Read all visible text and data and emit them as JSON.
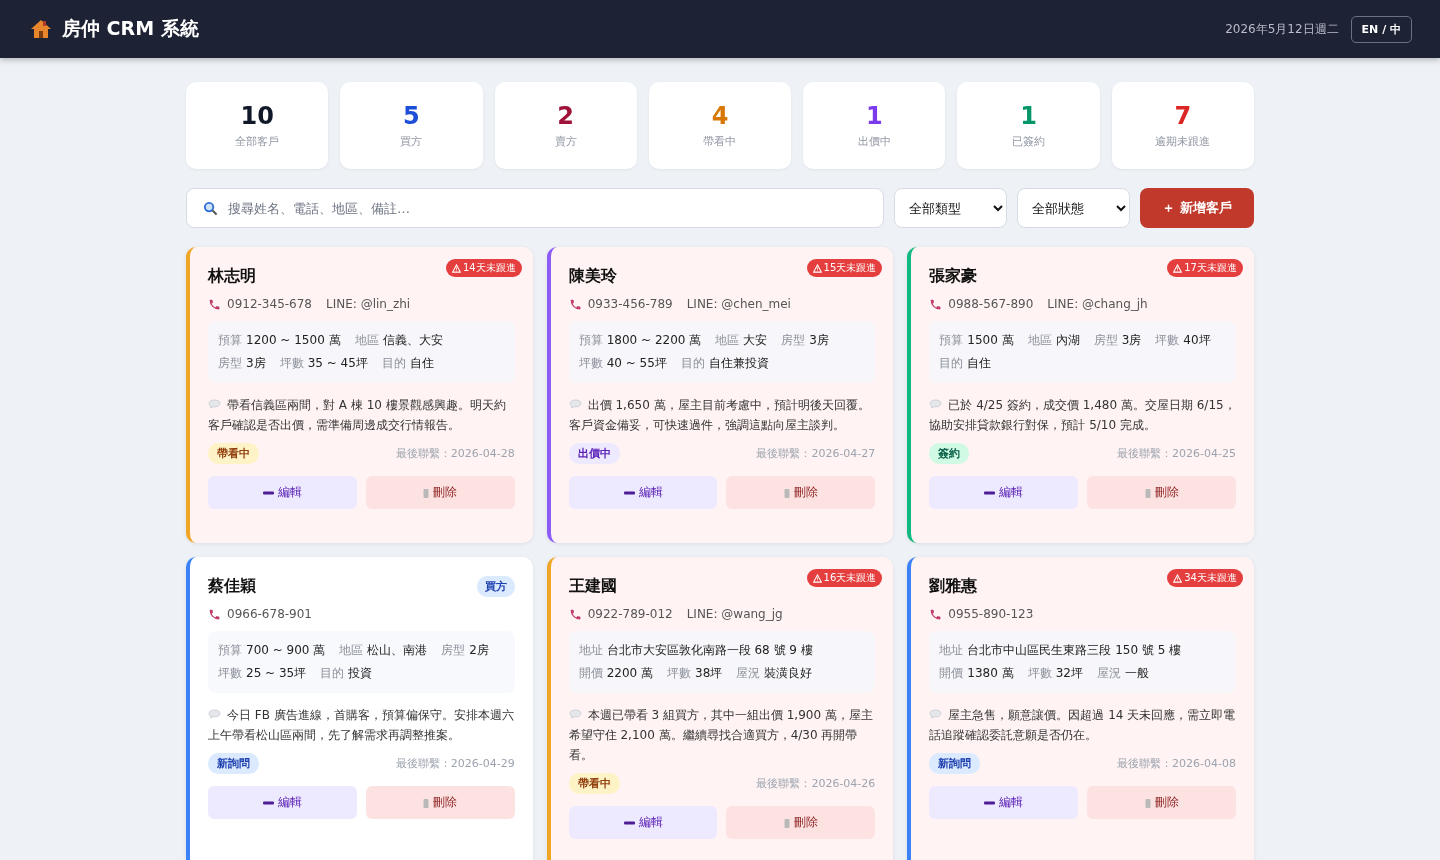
{
  "header": {
    "title": "房仲 CRM 系統",
    "date": "2026年5月12日週二",
    "language_button": "EN / 中"
  },
  "stats": [
    {
      "value": "10",
      "label": "全部客戶",
      "color": "#111827"
    },
    {
      "value": "5",
      "label": "買方",
      "color": "#1d4ed8"
    },
    {
      "value": "2",
      "label": "賣方",
      "color": "#9f1239"
    },
    {
      "value": "4",
      "label": "帶看中",
      "color": "#d97706"
    },
    {
      "value": "1",
      "label": "出價中",
      "color": "#7c3aed"
    },
    {
      "value": "1",
      "label": "已簽約",
      "color": "#059669"
    },
    {
      "value": "7",
      "label": "逾期未跟進",
      "color": "#dc2626"
    }
  ],
  "toolbar": {
    "search": {
      "placeholder": "搜尋姓名、電話、地區、備註…"
    },
    "type_filter": "全部類型",
    "status_filter": "全部狀態",
    "add_button": "＋ 新增客戶"
  },
  "clients": [
    {
      "name": "林志明",
      "overdue": "14天未跟進",
      "phone": "0912-345-678",
      "line": "LINE: @lin_zhi",
      "details": [
        {
          "label": "預算",
          "value": "1200 ~ 1500 萬"
        },
        {
          "label": "地區",
          "value": "信義、大安"
        },
        {
          "label": "房型",
          "value": "3房"
        },
        {
          "label": "坪數",
          "value": "35 ~ 45坪"
        },
        {
          "label": "目的",
          "value": "自住"
        }
      ],
      "note": "帶看信義區兩間，對 A 棟 10 樓景觀感興趣。明天約客戶確認是否出價，需準備周邊成交行情報告。",
      "status": {
        "kind": "viewing",
        "label": "帶看中"
      },
      "last_contact": "最後聯繫：2026-04-28",
      "edit": "編輯",
      "delete": "刪除"
    },
    {
      "name": "陳美玲",
      "overdue": "15天未跟進",
      "phone": "0933-456-789",
      "line": "LINE: @chen_mei",
      "details": [
        {
          "label": "預算",
          "value": "1800 ~ 2200 萬"
        },
        {
          "label": "地區",
          "value": "大安"
        },
        {
          "label": "房型",
          "value": "3房"
        },
        {
          "label": "坪數",
          "value": "40 ~ 55坪"
        },
        {
          "label": "目的",
          "value": "自住兼投資"
        }
      ],
      "note": "出價 1,650 萬，屋主目前考慮中，預計明後天回覆。客戶資金備妥，可快速過件，強調這點向屋主談判。",
      "status": {
        "kind": "offer",
        "label": "出價中"
      },
      "last_contact": "最後聯繫：2026-04-27",
      "edit": "編輯",
      "delete": "刪除"
    },
    {
      "name": "張家豪",
      "overdue": "17天未跟進",
      "phone": "0988-567-890",
      "line": "LINE: @chang_jh",
      "details": [
        {
          "label": "預算",
          "value": "1500 萬"
        },
        {
          "label": "地區",
          "value": "內湖"
        },
        {
          "label": "房型",
          "value": "3房"
        },
        {
          "label": "坪數",
          "value": "40坪"
        },
        {
          "label": "目的",
          "value": "自住"
        }
      ],
      "note": "已於 4/25 簽約，成交價 1,480 萬。交屋日期 6/15，協助安排貸款銀行對保，預計 5/10 完成。",
      "status": {
        "kind": "signed",
        "label": "簽約"
      },
      "last_contact": "最後聯繫：2026-04-25",
      "edit": "編輯",
      "delete": "刪除"
    },
    {
      "name": "蔡佳穎",
      "type": "買方",
      "phone": "0966-678-901",
      "details": [
        {
          "label": "預算",
          "value": "700 ~ 900 萬"
        },
        {
          "label": "地區",
          "value": "松山、南港"
        },
        {
          "label": "房型",
          "value": "2房"
        },
        {
          "label": "坪數",
          "value": "25 ~ 35坪"
        },
        {
          "label": "目的",
          "value": "投資"
        }
      ],
      "note": "今日 FB 廣告進線，首購客，預算偏保守。安排本週六上午帶看松山區兩間，先了解需求再調整推案。",
      "status": {
        "kind": "new",
        "label": "新詢問"
      },
      "last_contact": "最後聯繫：2026-04-29",
      "edit": "編輯",
      "delete": "刪除"
    },
    {
      "name": "王建國",
      "overdue": "16天未跟進",
      "phone": "0922-789-012",
      "line": "LINE: @wang_jg",
      "details": [
        {
          "label": "地址",
          "value": "台北市大安區敦化南路一段 68 號 9 樓"
        },
        {
          "label": "開價",
          "value": "2200 萬"
        },
        {
          "label": "坪數",
          "value": "38坪"
        },
        {
          "label": "屋況",
          "value": "裝潢良好"
        }
      ],
      "note": "本週已帶看 3 組買方，其中一組出價 1,900 萬，屋主希望守住 2,100 萬。繼續尋找合適買方，4/30 再開帶看。",
      "status": {
        "kind": "viewing",
        "label": "帶看中"
      },
      "last_contact": "最後聯繫：2026-04-26",
      "edit": "編輯",
      "delete": "刪除"
    },
    {
      "name": "劉雅惠",
      "overdue": "34天未跟進",
      "phone": "0955-890-123",
      "details": [
        {
          "label": "地址",
          "value": "台北市中山區民生東路三段 150 號 5 樓"
        },
        {
          "label": "開價",
          "value": "1380 萬"
        },
        {
          "label": "坪數",
          "value": "32坪"
        },
        {
          "label": "屋況",
          "value": "一般"
        }
      ],
      "note": "屋主急售，願意讓價。因超過 14 天未回應，需立即電話追蹤確認委託意願是否仍在。",
      "status": {
        "kind": "new",
        "label": "新詢問"
      },
      "last_contact": "最後聯繫：2026-04-08",
      "edit": "編輯",
      "delete": "刪除"
    }
  ]
}
